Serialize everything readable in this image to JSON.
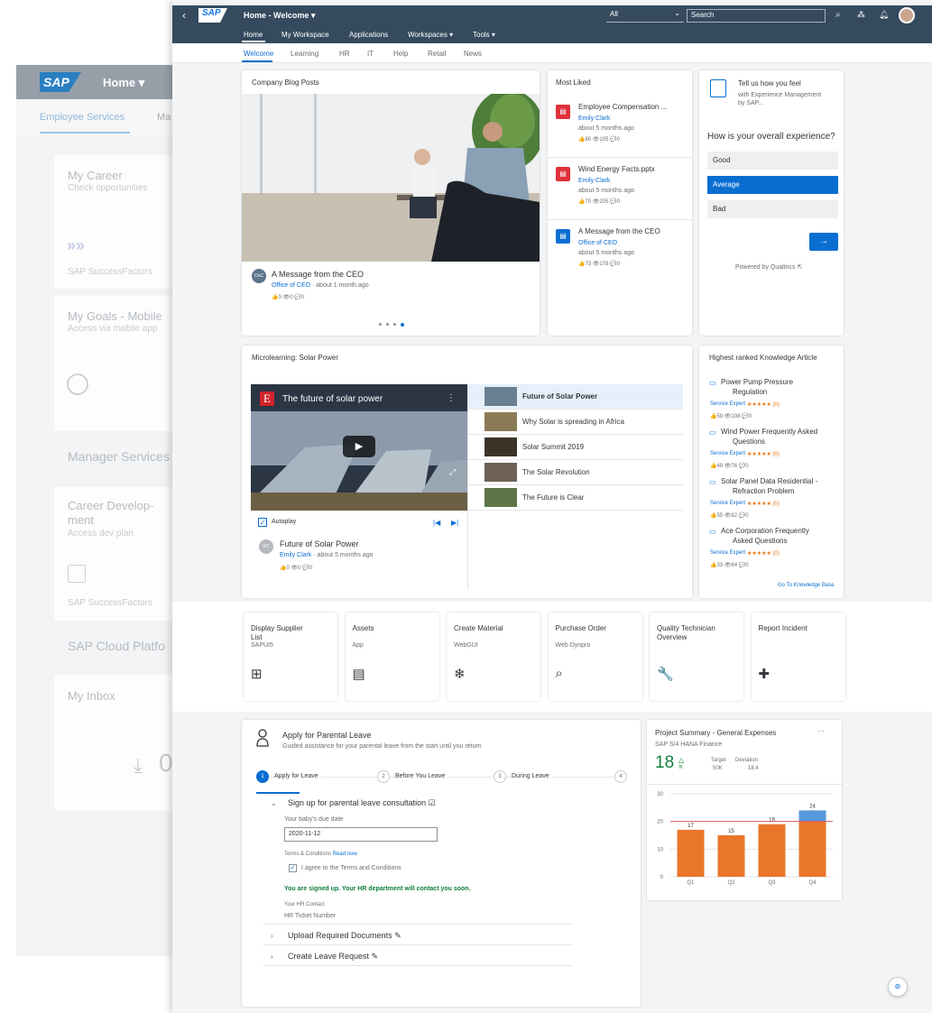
{
  "background_app": {
    "logo": "SAP",
    "home": "Home ▾",
    "tabs": [
      "Employee Services",
      "Ma"
    ],
    "cards": [
      {
        "title": "My Career",
        "subtitle": "Check opportunities",
        "footer": "SAP SuccessFactors"
      },
      {
        "title": "My Goals - Mobile",
        "subtitle": "Access via mobile app"
      },
      {
        "title": "Career Develop-",
        "title2": "ment",
        "subtitle": "Access dev plan",
        "footer": "SAP SuccessFactors"
      },
      {
        "title": "My Inbox"
      }
    ],
    "sections": [
      "Manager Services",
      "SAP Cloud Platfo"
    ],
    "inbox_count": "0"
  },
  "shell": {
    "logo": "SAP",
    "title": "Home - Welcome ▾",
    "search_scope": "All",
    "search_placeholder": "Search",
    "nav": [
      "Home",
      "My Workspace",
      "Applications",
      "Workspaces ▾",
      "Tools ▾"
    ],
    "subtabs": [
      "Welcome",
      "Learning",
      "HR",
      "IT",
      "Help",
      "Retail",
      "News"
    ]
  },
  "blog": {
    "title": "Company Blog Posts",
    "avatar": "OoC",
    "post_title": "A Message from the CEO",
    "post_author": "Office of CEO",
    "post_time": " · about 1 month ago",
    "stats": "👍0  👁0  💬0"
  },
  "most_liked": {
    "title": "Most Liked",
    "items": [
      {
        "title": "Employee Compensation ...",
        "author": "Emily Clark",
        "time": "about 5 months ago",
        "stats": "👍80 👁105 💬0",
        "color": "#e0303a"
      },
      {
        "title": "Wind Energy Facts.pptx",
        "author": "Emily Clark",
        "time": "about 5 months ago",
        "stats": "👍70 👁205 💬0",
        "color": "#e0303a"
      },
      {
        "title": "A Message from the CEO",
        "author": "Office of CEO",
        "time": "about 5 months ago",
        "stats": "👍73 👁178 💬0",
        "color": "#0a6ed1"
      }
    ]
  },
  "survey": {
    "title": "Tell us how you feel",
    "subtitle": "with Experience Management by SAP...",
    "question": "How is your overall experience?",
    "options": [
      "Good",
      "Average",
      "Bad"
    ],
    "selected": "Average",
    "next": "→",
    "powered": "Powered by Qualtrics ⇱"
  },
  "microlearning": {
    "title": "Microlearning: Solar Power",
    "video_title": "The future of solar power",
    "video_badge": "E",
    "autoplay": "Autoplay",
    "prev": "|◀",
    "next": "▶|",
    "playlist": [
      "Future of Solar Power",
      "Why Solar is spreading in Africa",
      "Solar Summit 2019",
      "The Solar Revolution",
      "The Future is Clear"
    ],
    "post_avatar": "EC",
    "post_title": "Future of Solar Power",
    "post_author": "Emily Clark",
    "post_time": " · about 5 months ago",
    "stats": "👍0 👁0 💬0"
  },
  "knowledge": {
    "title": "Highest ranked Knowledge Article",
    "items": [
      {
        "title": "Power Pump Pressure",
        "title2": "Regulation",
        "badge": "Service Expert",
        "stars": "★★★★★ (0)",
        "stats": "👍59 👁108 💬0"
      },
      {
        "title": "Wind Power Frequently Asked",
        "title2": "Questions",
        "badge": "Service Expert",
        "stars": "★★★★★ (0)",
        "stats": "👍49 👁76 💬0"
      },
      {
        "title": "Solar Panel Data Residential -",
        "title2": "Refraction Problem",
        "badge": "Service Expert",
        "stars": "★★★★★ (0)",
        "stats": "👍55 👁82 💬0"
      },
      {
        "title": "Ace Corporation Frequently",
        "title2": "Asked Questions",
        "badge": "Service Expert",
        "stars": "★★★★★ (0)",
        "stats": "👍33 👁64 💬0"
      }
    ],
    "link": "Go To Knowledge Base"
  },
  "tiles": [
    {
      "title": "Display Supplier",
      "title2": "List",
      "sub": "SAPUI5",
      "icon": "⊞"
    },
    {
      "title": "Assets",
      "title2": "",
      "sub": "App",
      "icon": "▤"
    },
    {
      "title": "Create Material",
      "title2": "",
      "sub": "WebGUI",
      "icon": "❄"
    },
    {
      "title": "Purchase Order",
      "title2": "",
      "sub": "Web Dynpro",
      "icon": "⌕"
    },
    {
      "title": "Quality Technician",
      "title2": "Overview",
      "sub": "",
      "icon": "🔧"
    },
    {
      "title": "Report Incident",
      "title2": "",
      "sub": "",
      "icon": "✚"
    }
  ],
  "parental": {
    "title": "Apply for Parental Leave",
    "subtitle": "Guided assistance for your parental leave from the start until you return",
    "steps": [
      {
        "n": "1",
        "label": "Apply for Leave"
      },
      {
        "n": "2",
        "label": "Before You Leave"
      },
      {
        "n": "3",
        "label": "During Leave"
      },
      {
        "n": "4",
        "label": ""
      }
    ],
    "section1": "Sign up for parental leave consultation ☑",
    "due_label": "Your baby's due date",
    "due_value": "2020-11-12",
    "terms_label": "Terms & Conditions",
    "terms_link": "Read now",
    "agree": "I agree to the Terms and Conditions",
    "confirm": "You are signed up. Your HR department will contact you soon.",
    "contact_label": "Your HR Contact",
    "contact_value": "HR Ticket Number",
    "section2": "Upload Required Documents ✎",
    "section3": "Create Leave Request ✎"
  },
  "project": {
    "title": "Project Summary - General Expenses",
    "more": "···",
    "subtitle": "SAP S/4 HANA  Finance",
    "kpi": "18",
    "kpi_unit": "K",
    "target_label": "Target",
    "target_value": "50K",
    "deviation_label": "Deviation",
    "deviation_value": "18.4"
  },
  "chart_data": {
    "type": "bar",
    "categories": [
      "Q1",
      "Q2",
      "Q3",
      "Q4"
    ],
    "values": [
      17,
      15,
      19,
      24
    ],
    "ylim": [
      0,
      30
    ],
    "yticks": [
      0,
      10,
      20,
      30
    ],
    "target_line": 20,
    "colors": {
      "bar": "#e9762b",
      "overflow": "#5899da",
      "target": "#e05a5a"
    }
  }
}
